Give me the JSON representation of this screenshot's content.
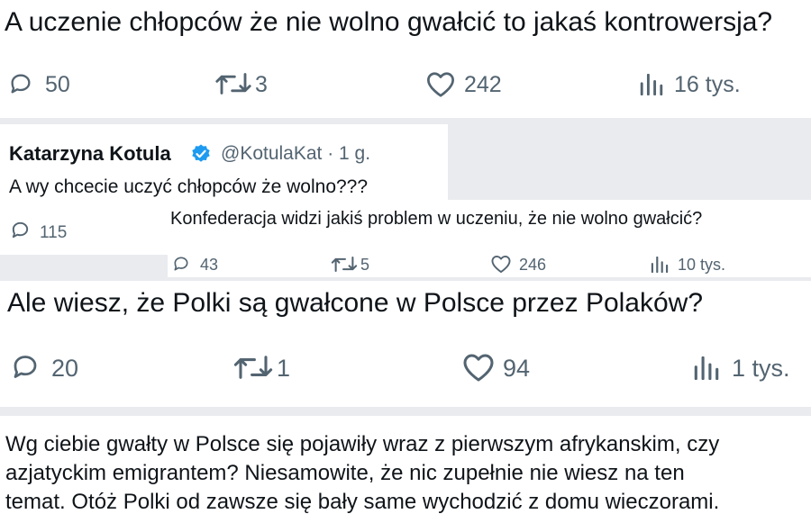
{
  "post1": {
    "text": "A uczenie chłopców że nie wolno gwałcić to jakaś kontrowersja?",
    "replies": "50",
    "reposts": "3",
    "likes": "242",
    "views": "16 tys."
  },
  "post2": {
    "author_name": "Katarzyna Kotula",
    "handle_time": "@KotulaKat · 1 g.",
    "text": "A wy chcecie uczyć chłopców  że wolno???",
    "replies": "115"
  },
  "post3": {
    "text": "Konfederacja widzi jakiś problem w uczeniu, że nie wolno gwałcić?",
    "replies": "43",
    "reposts": "5",
    "likes": "246",
    "views": "10 tys."
  },
  "post4": {
    "text": "Ale wiesz, że Polki są gwałcone w Polsce przez Polaków?",
    "replies": "20",
    "reposts": "1",
    "likes": "94",
    "views": "1 tys."
  },
  "post5": {
    "lines": [
      "Wg ciebie gwałty w Polsce się pojawiły wraz z pierwszym afrykanskim, czy",
      "azjatyckim emigrantem? Niesamowite, że nic zupełnie nie wiesz na ten",
      "temat. Otóż Polki od zawsze się bały same wychodzić z domu wieczorami."
    ]
  },
  "colors": {
    "text": "#0f1419",
    "secondary": "#536471",
    "verified": "#1d9bf0",
    "background": "#e9ebee"
  },
  "icons": [
    "reply-icon",
    "repost-icon",
    "like-icon",
    "views-icon",
    "verified-badge-icon"
  ]
}
